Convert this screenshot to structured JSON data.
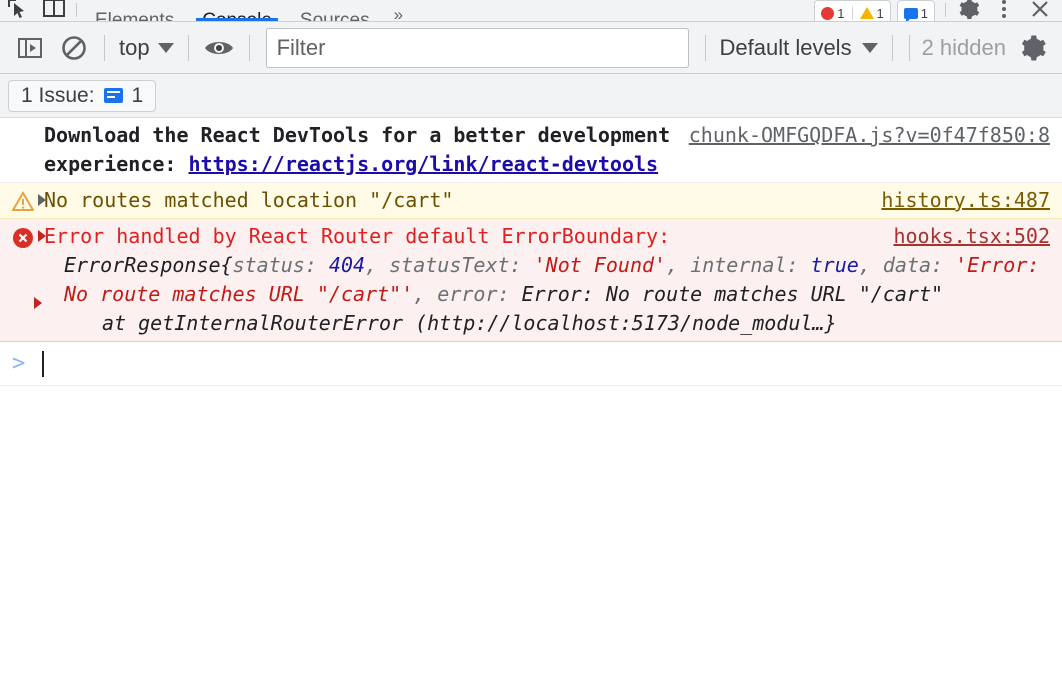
{
  "devtools": {
    "tabs": [
      {
        "label": "Elements",
        "active": false
      },
      {
        "label": "Console",
        "active": true
      },
      {
        "label": "Sources",
        "active": false
      }
    ],
    "more_tabs_label": "»",
    "counters": {
      "errors": "1",
      "warnings": "1",
      "info": "1"
    },
    "inspect_icon": "inspect-element-icon",
    "device_toolbar_icon": "device-toolbar-icon",
    "settings_icon": "settings-gear-icon",
    "more_options_icon": "more-vertical-icon",
    "close_icon": "close-icon"
  },
  "toolbar": {
    "sidebar_toggle_icon": "console-sidebar-icon",
    "clear_console_icon": "clear-console-icon",
    "context_selector": "top",
    "live_expression_icon": "eye-icon",
    "filter_placeholder": "Filter",
    "filter_value": "",
    "levels_label": "Default levels",
    "hidden_label": "2 hidden",
    "settings_icon": "gear-icon"
  },
  "issues": {
    "label": "1 Issue:",
    "icon": "issues-message-icon",
    "count": "1"
  },
  "messages": [
    {
      "type": "info",
      "source": "chunk-OMFGQDFA.js?v=0f47f850:8",
      "text": "Download the React DevTools for a better development experience: ",
      "link": "https://reactjs.org/link/react-devtools"
    },
    {
      "type": "warning",
      "icon": "warning-triangle-icon",
      "source": "history.ts:487",
      "text": "No routes matched location \"/cart\""
    },
    {
      "type": "error",
      "icon": "error-circle-icon",
      "source": "hooks.tsx:502",
      "headline": "Error handled by React Router default ErrorBoundary:",
      "object_name": "ErrorResponse",
      "fields": {
        "open_brace": "{",
        "status_key": "status: ",
        "status_value": "404",
        "statusText_key": "statusText: ",
        "statusText_value": "'Not Found'",
        "internal_key": "internal: ",
        "internal_value": "true",
        "data_key": "data: ",
        "data_value": "'Error: No route matches URL \"/cart\"'",
        "error_key": "error: ",
        "error_value": "Error: No route matches URL \"/cart\""
      },
      "stack_line": "at getInternalRouterError (http://localhost:5173/node_modul…}"
    }
  ],
  "prompt": {
    "chevron": ">",
    "value": ""
  }
}
